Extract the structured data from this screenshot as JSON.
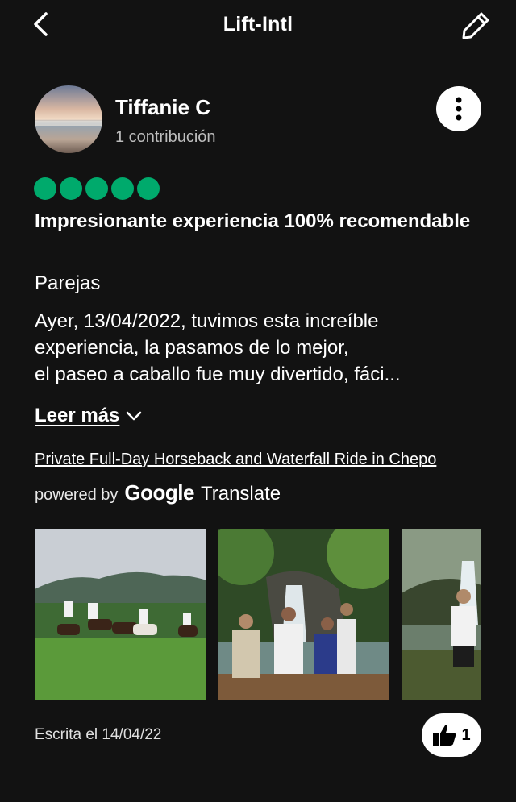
{
  "header": {
    "title": "Lift-Intl",
    "back_icon": "chevron-left-icon",
    "edit_icon": "pencil-icon"
  },
  "review": {
    "author": "Tiffanie C",
    "contributions": "1 contribución",
    "rating": 5,
    "rating_color": "#00aa6c",
    "title": "Impresionante experiencia 100% recomendable",
    "trip_type": "Parejas",
    "body_lines": [
      "Ayer, 13/04/2022, tuvimos esta increíble",
      "experiencia, la pasamos de lo mejor,",
      "el paseo a caballo fue muy divertido, fáci..."
    ],
    "read_more": "Leer más",
    "tour_link": "Private Full-Day Horseback and Waterfall Ride in Chepo",
    "powered_by": "powered by",
    "google": "Google",
    "translate": "Translate",
    "written_date": "Escrita el 14/04/22",
    "likes": "1"
  },
  "photos": [
    {
      "subject": "horseback riders in green field"
    },
    {
      "subject": "group posing in front of waterfall"
    },
    {
      "subject": "person standing near waterfall"
    }
  ]
}
